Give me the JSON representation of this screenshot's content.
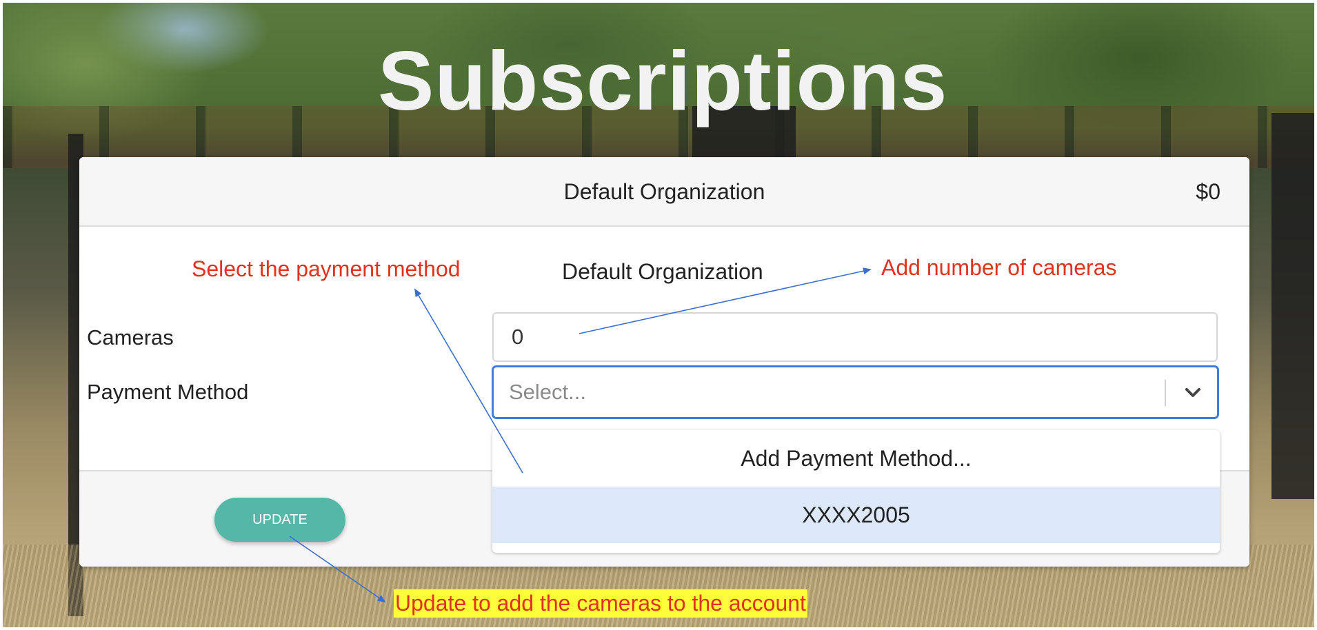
{
  "page": {
    "title": "Subscriptions"
  },
  "card": {
    "header_org": "Default Organization",
    "header_price": "$0",
    "body_org": "Default Organization",
    "cameras_label": "Cameras",
    "cameras_value": "0",
    "payment_label": "Payment Method",
    "payment_placeholder": "Select...",
    "update_label": "UPDATE"
  },
  "dropdown": {
    "options": [
      "Add Payment Method...",
      "XXXX2005"
    ],
    "highlighted_index": 1
  },
  "annotations": {
    "select_payment": "Select the payment method",
    "add_cameras": "Add number of  cameras",
    "update_note": "Update to add the cameras to the account"
  },
  "colors": {
    "accent_button": "#55b7a8",
    "select_border": "#3b7fe0",
    "annotation_text": "#e0321e",
    "annotation_highlight": "#fdfd3a",
    "arrow": "#3a6fd0"
  },
  "icons": {
    "select_chevron": "chevron-down-icon"
  }
}
